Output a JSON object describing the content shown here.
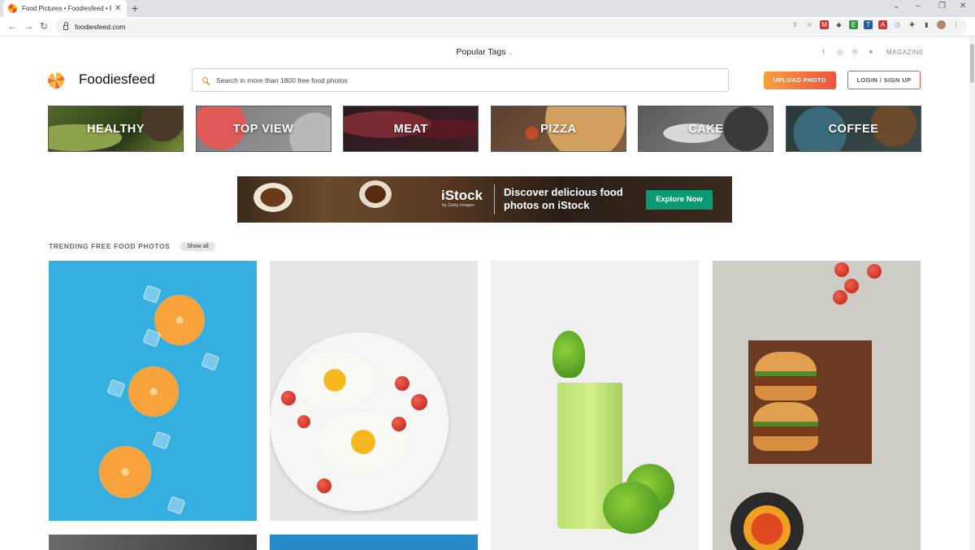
{
  "browser": {
    "tab_title": "Food Pictures • Foodiesfeed • Fre",
    "tab_close": "✕",
    "new_tab": "+",
    "url": "foodiesfeed.com",
    "nav": {
      "back": "←",
      "forward": "→",
      "reload": "↻"
    },
    "window_controls": {
      "dropdown": "⌄",
      "minimize": "–",
      "restore": "❐",
      "close": "✕"
    },
    "extensions": [
      {
        "name": "share-icon",
        "glyph": "⇪",
        "color": "#777777"
      },
      {
        "name": "star-icon",
        "glyph": "☆",
        "color": "#555555"
      },
      {
        "name": "gmail-icon",
        "glyph": "M",
        "color": "#d93025"
      },
      {
        "name": "extension-icon",
        "glyph": "◆",
        "color": "#555555"
      },
      {
        "name": "evernote-icon",
        "glyph": "E",
        "color": "#2e9a44"
      },
      {
        "name": "trello-icon",
        "glyph": "T",
        "color": "#1a5fb4"
      },
      {
        "name": "ad-icon",
        "glyph": "A",
        "color": "#d9362b"
      },
      {
        "name": "history-icon",
        "glyph": "◷",
        "color": "#888888"
      },
      {
        "name": "puzzle-icon",
        "glyph": "✚",
        "color": "#555555"
      },
      {
        "name": "sidebar-icon",
        "glyph": "▮",
        "color": "#555555"
      },
      {
        "name": "profile-avatar",
        "glyph": "●",
        "color": "#b08a6a"
      },
      {
        "name": "menu-icon",
        "glyph": "⋮",
        "color": "#555555"
      }
    ]
  },
  "header": {
    "popular_tags": "Popular Tags",
    "popular_tags_chevron": "⌄",
    "social": [
      {
        "name": "facebook-icon",
        "glyph": "f"
      },
      {
        "name": "instagram-icon",
        "glyph": "◎"
      },
      {
        "name": "pinterest-icon",
        "glyph": "℗"
      },
      {
        "name": "twitter-icon",
        "glyph": "✦"
      }
    ],
    "magazine": "MAGAZINE",
    "logo": "Foodiesfeed",
    "search_placeholder": "Search in more than 1800 free food photos",
    "upload_label": "UPLOAD PHOTO",
    "login_label": "LOGIN / SIGN UP"
  },
  "categories": [
    "HEALTHY",
    "TOP VIEW",
    "MEAT",
    "PIZZA",
    "CAKE",
    "COFFEE"
  ],
  "ad": {
    "brand": "iStock",
    "brand_sub": "by Getty Images",
    "headline": "Discover delicious food photos on iStock",
    "cta": "Explore Now"
  },
  "trending": {
    "title": "TRENDING FREE FOOD PHOTOS",
    "show_all": "Show all"
  },
  "colors": {
    "accent_orange": "#f7a13a",
    "accent_red": "#ef5142",
    "istock_green": "#0c9a74"
  }
}
